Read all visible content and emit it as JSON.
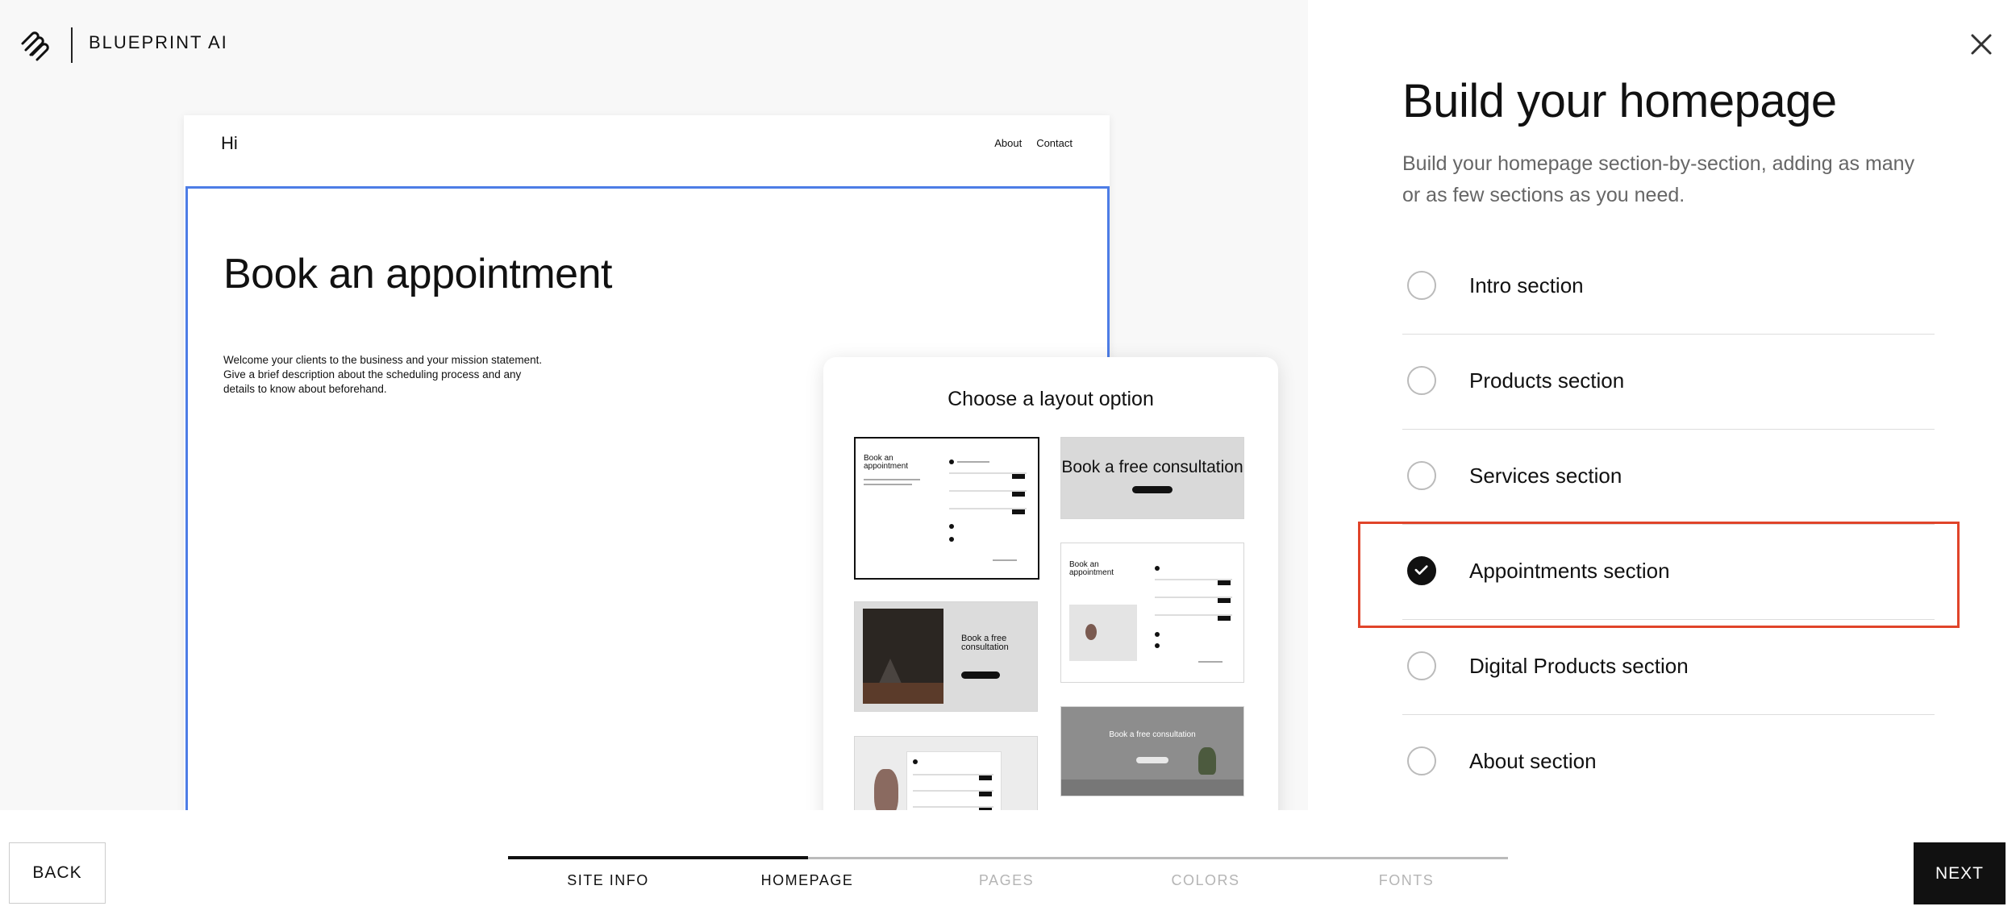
{
  "header": {
    "brand": "BLUEPRINT AI"
  },
  "preview": {
    "site_title": "Hi",
    "nav_links": [
      "About",
      "Contact"
    ],
    "section_title": "Book an appointment",
    "section_description": "Welcome your clients to the business and your mission statement. Give a brief description about the scheduling process and any details to know about beforehand."
  },
  "layout_picker": {
    "title": "Choose a layout option",
    "thumbnails": [
      {
        "label": "Book an appointment",
        "selected": true
      },
      {
        "label": "Book a free consultation",
        "selected": false
      },
      {
        "label": "Book an appointment",
        "selected": false
      },
      {
        "label": "Book a free consultation",
        "selected": false
      },
      {
        "label": "Book a free consultation",
        "selected": false
      },
      {
        "label": "",
        "selected": false
      }
    ]
  },
  "panel": {
    "title": "Build your homepage",
    "description": "Build your homepage section-by-section, adding as many or as few sections as you need.",
    "options": [
      {
        "label": "Intro section",
        "checked": false
      },
      {
        "label": "Products section",
        "checked": false
      },
      {
        "label": "Services section",
        "checked": false
      },
      {
        "label": "Appointments section",
        "checked": true
      },
      {
        "label": "Digital Products section",
        "checked": false
      },
      {
        "label": "About section",
        "checked": false
      }
    ]
  },
  "footer": {
    "back_label": "BACK",
    "next_label": "NEXT",
    "progress": 0.3,
    "steps": [
      {
        "label": "SITE INFO",
        "state": "done"
      },
      {
        "label": "HOMEPAGE",
        "state": "current"
      },
      {
        "label": "PAGES",
        "state": "upcoming"
      },
      {
        "label": "COLORS",
        "state": "upcoming"
      },
      {
        "label": "FONTS",
        "state": "upcoming"
      }
    ]
  },
  "colors": {
    "accent_blue": "#4d7de6",
    "highlight_red": "#e0442a",
    "primary_black": "#111111"
  }
}
